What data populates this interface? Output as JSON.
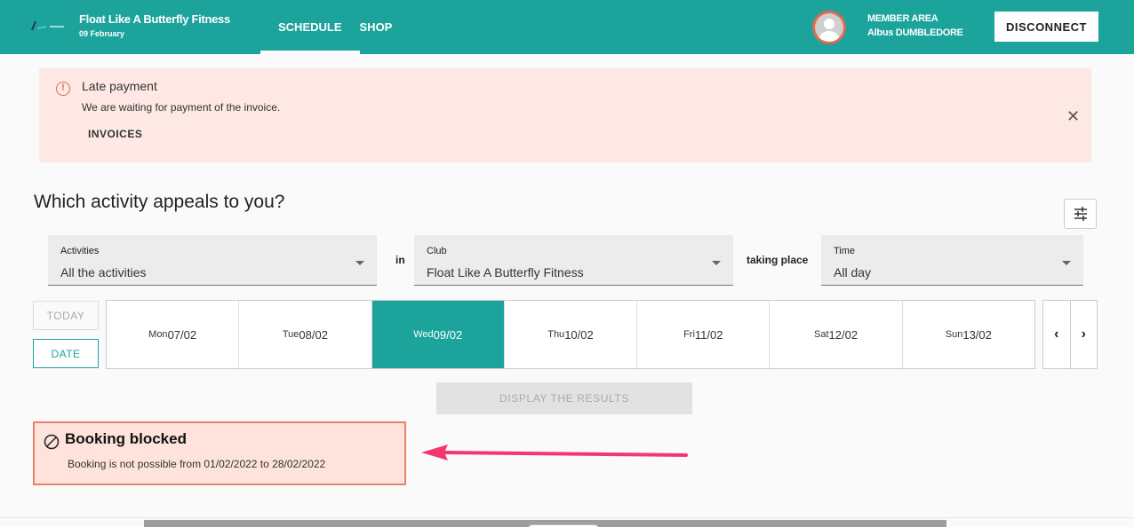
{
  "header": {
    "brand_name": "Float Like A Butterfly Fitness",
    "brand_date": "09 February",
    "nav": [
      "SCHEDULE",
      "SHOP"
    ],
    "member_area": "MEMBER AREA",
    "member_name": "Albus DUMBLEDORE",
    "disconnect_label": "DISCONNECT",
    "accent_color": "#1ba39c"
  },
  "alert": {
    "title": "Late payment",
    "text": "We are waiting for payment of the invoice.",
    "link": "INVOICES",
    "close": "✕",
    "icon": "!"
  },
  "search": {
    "heading": "Which activity appeals to you?",
    "activities": {
      "label": "Activities",
      "value": "All the activities"
    },
    "in_label": "in",
    "club": {
      "label": "Club",
      "value": "Float Like A Butterfly Fitness"
    },
    "taking_place_label": "taking place",
    "time": {
      "label": "Time",
      "value": "All day"
    }
  },
  "dates": {
    "today_label": "TODAY",
    "date_label": "DATE",
    "days": [
      {
        "name": "Mon",
        "date": "07/02"
      },
      {
        "name": "Tue",
        "date": "08/02"
      },
      {
        "name": "Wed",
        "date": "09/02"
      },
      {
        "name": "Thu",
        "date": "10/02"
      },
      {
        "name": "Fri",
        "date": "11/02"
      },
      {
        "name": "Sat",
        "date": "12/02"
      },
      {
        "name": "Sun",
        "date": "13/02"
      }
    ],
    "selected_index": 2,
    "prev": "‹",
    "next": "›"
  },
  "display_results_label": "DISPLAY THE RESULTS",
  "blocked": {
    "title": "Booking blocked",
    "text": "Booking is not possible from 01/02/2022 to 28/02/2022"
  }
}
